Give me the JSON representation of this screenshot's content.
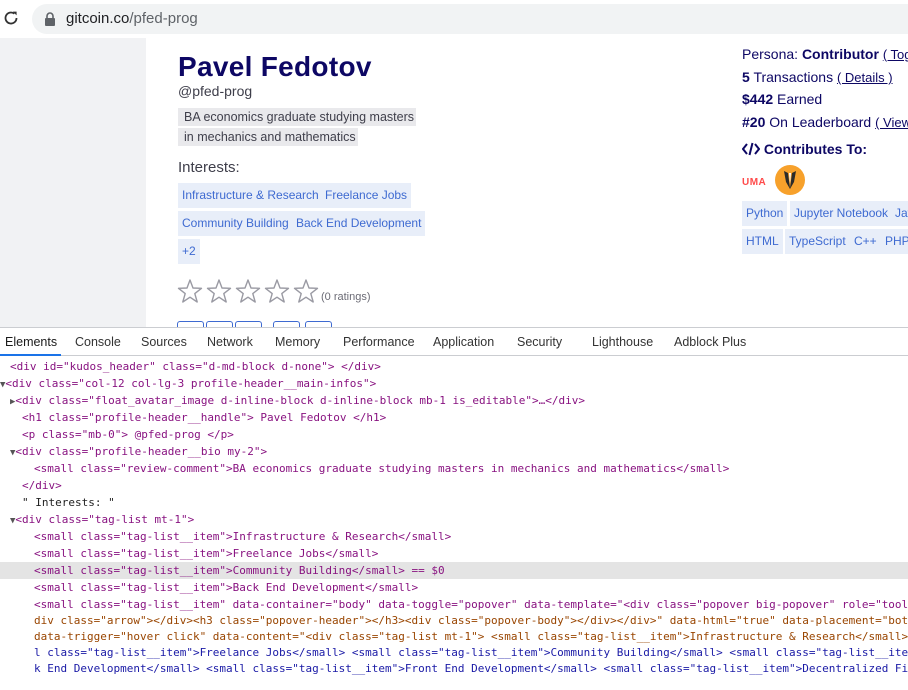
{
  "browser": {
    "url_host": "gitcoin.co",
    "url_path": "/pfed-prog"
  },
  "profile": {
    "name": "Pavel Fedotov",
    "handle": "@pfed-prog",
    "bio_line1": "BA economics graduate studying masters",
    "bio_line2": "in mechanics and mathematics",
    "interests_label": "Interests:",
    "tags": [
      "Infrastructure & Research",
      "Freelance Jobs",
      "Community Building",
      "Back End Development",
      "+2"
    ],
    "ratings_text": "(0 ratings)",
    "rating_value": 0,
    "rating_max": 5
  },
  "sidebar": {
    "persona_label": "Persona:",
    "persona_value": "Contributor",
    "persona_link": "( Togg",
    "transactions_count": "5",
    "transactions_label": "Transactions",
    "transactions_link": "( Details )",
    "earned_value": "$442",
    "earned_label": "Earned",
    "leaderboard_rank": "#20",
    "leaderboard_label": "On Leaderboard",
    "leaderboard_link": "( View",
    "contributes_label": "Contributes To:",
    "org_logo_text": "UMA",
    "languages": [
      "Python",
      "Jupyter Notebook",
      "Jav",
      "HTML",
      "TypeScript",
      "C++",
      "PHP"
    ]
  },
  "devtools": {
    "tabs": [
      "Elements",
      "Console",
      "Sources",
      "Network",
      "Memory",
      "Performance",
      "Application",
      "Security",
      "Lighthouse",
      "Adblock Plus"
    ],
    "active_tab": "Elements",
    "lines": [
      "<div id=\"kudos_header\" class=\"d-md-block d-none\"> </div>",
      "<div class=\"col-12 col-lg-3 profile-header__main-infos\">",
      "<div class=\"float_avatar_image d-inline-block d-inline-block mb-1 is_editable\">…</div>",
      "<h1 class=\"profile-header__handle\"> Pavel Fedotov </h1>",
      "<p class=\"mb-0\"> @pfed-prog </p>",
      "<div class=\"profile-header__bio my-2\">",
      "<small class=\"review-comment\">BA economics graduate studying masters in mechanics and mathematics</small>",
      "</div>",
      "\" Interests: \"",
      "<div class=\"tag-list mt-1\">",
      "<small class=\"tag-list__item\">Infrastructure & Research</small>",
      "<small class=\"tag-list__item\">Freelance Jobs</small>",
      "<small class=\"tag-list__item\">Community Building</small> == $0",
      "<small class=\"tag-list__item\">Back End Development</small>",
      "<small class=\"tag-list__item\" data-container=\"body\" data-toggle=\"popover\" data-template=\"<div class=\"popover big-popover\" role=\"toolt",
      "div class=\"arrow\"></div><h3 class=\"popover-header\"></h3><div class=\"popover-body\"></div></div>\" data-html=\"true\" data-placement=\"bott",
      "data-trigger=\"hover click\" data-content=\"<div class=\"tag-list mt-1\"> <small class=\"tag-list__item\">Infrastructure & Research</small> <",
      "l class=\"tag-list__item\">Freelance Jobs</small> <small class=\"tag-list__item\">Community Building</small> <small class=\"tag-list__iter",
      "k End Development</small> <small class=\"tag-list__item\">Front End Development</small> <small class=\"tag-list__item\">Decentralized Fir"
    ]
  }
}
